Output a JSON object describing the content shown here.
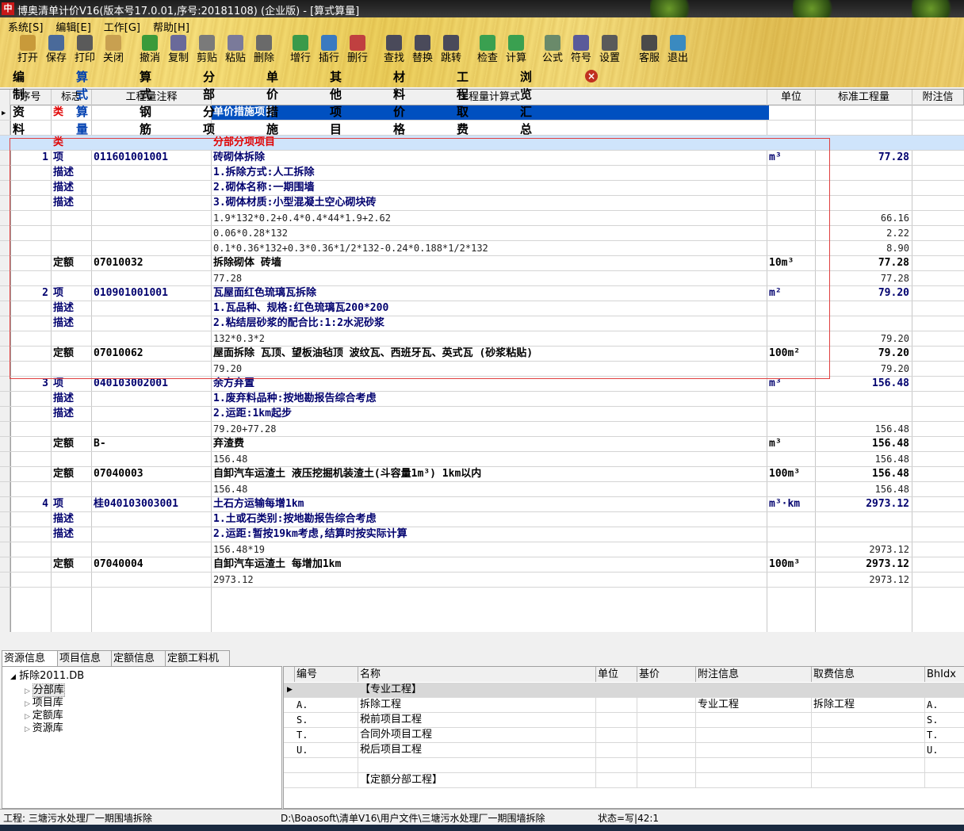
{
  "window": {
    "title": "博奥清单计价V16(版本号17.0.01,序号:20181108) (企业版) - [算式算量]",
    "app_icon": "中"
  },
  "menu": [
    "系统[S]",
    "编辑[E]",
    "工作[G]",
    "帮助[H]"
  ],
  "toolbar": [
    {
      "label": "打开",
      "icon": "folder-open-icon"
    },
    {
      "label": "保存",
      "icon": "save-icon"
    },
    {
      "label": "打印",
      "icon": "print-icon"
    },
    {
      "label": "关闭",
      "icon": "close-folder-icon"
    },
    {
      "label": "撤消",
      "icon": "undo-icon"
    },
    {
      "label": "复制",
      "icon": "copy-icon"
    },
    {
      "label": "剪贴",
      "icon": "cut-icon"
    },
    {
      "label": "粘贴",
      "icon": "paste-icon"
    },
    {
      "label": "删除",
      "icon": "delete-icon"
    },
    {
      "label": "增行",
      "icon": "add-row-icon"
    },
    {
      "label": "插行",
      "icon": "insert-row-icon"
    },
    {
      "label": "删行",
      "icon": "delete-row-icon"
    },
    {
      "label": "查找",
      "icon": "find-icon"
    },
    {
      "label": "替换",
      "icon": "replace-icon"
    },
    {
      "label": "跳转",
      "icon": "jump-icon"
    },
    {
      "label": "检查",
      "icon": "check-icon"
    },
    {
      "label": "计算",
      "icon": "calculate-icon"
    },
    {
      "label": "公式",
      "icon": "formula-icon"
    },
    {
      "label": "符号",
      "icon": "symbol-icon"
    },
    {
      "label": "设置",
      "icon": "settings-icon"
    },
    {
      "label": "客服",
      "icon": "headset-icon"
    },
    {
      "label": "退出",
      "icon": "exit-icon"
    }
  ],
  "tabs": [
    "编制资料",
    "算式算量",
    "算式钢筋",
    "分部分项",
    "单价措施",
    "其他项目",
    "材料价格",
    "工程取费",
    "浏览汇总"
  ],
  "active_tab": "算式算量",
  "grid": {
    "headers": [
      "序号",
      "标志",
      "工程量注释",
      "工程量计算式",
      "单位",
      "标准工程量",
      "附注信"
    ],
    "rows": [
      {
        "no": "",
        "flag": "类",
        "code": "",
        "formula": "单价措施项目",
        "unit": "",
        "qty": "",
        "style": "cat-selected"
      },
      {
        "no": "",
        "flag": "",
        "code": "",
        "formula": "",
        "unit": "",
        "qty": "",
        "style": "plain"
      },
      {
        "no": "",
        "flag": "类",
        "code": "",
        "formula": "分部分项项目",
        "unit": "",
        "qty": "",
        "style": "cat"
      },
      {
        "no": "1",
        "flag": "项",
        "code": "011601001001",
        "formula": "砖砌体拆除",
        "unit": "m³",
        "qty": "77.28",
        "style": "item"
      },
      {
        "no": "",
        "flag": "描述",
        "code": "",
        "formula": "1.拆除方式:人工拆除",
        "unit": "",
        "qty": "",
        "style": "desc"
      },
      {
        "no": "",
        "flag": "描述",
        "code": "",
        "formula": "2.砌体名称:一期围墙",
        "unit": "",
        "qty": "",
        "style": "desc"
      },
      {
        "no": "",
        "flag": "描述",
        "code": "",
        "formula": "3.砌体材质:小型混凝土空心砌块砖",
        "unit": "",
        "qty": "",
        "style": "desc"
      },
      {
        "no": "",
        "flag": "",
        "code": "",
        "formula": "1.9*132*0.2+0.4*0.4*44*1.9+2.62",
        "unit": "",
        "qty": "66.16",
        "style": "calc"
      },
      {
        "no": "",
        "flag": "",
        "code": "",
        "formula": "0.06*0.28*132",
        "unit": "",
        "qty": "2.22",
        "style": "calc"
      },
      {
        "no": "",
        "flag": "",
        "code": "",
        "formula": "0.1*0.36*132+0.3*0.36*1/2*132-0.24*0.188*1/2*132",
        "unit": "",
        "qty": "8.90",
        "style": "calc"
      },
      {
        "no": "",
        "flag": "定额",
        "code": "07010032",
        "formula": "拆除砌体 砖墙",
        "unit": "10m³",
        "qty": "77.28",
        "style": "quota"
      },
      {
        "no": "",
        "flag": "",
        "code": "",
        "formula": "77.28",
        "unit": "",
        "qty": "77.28",
        "style": "calc"
      },
      {
        "no": "2",
        "flag": "项",
        "code": "010901001001",
        "formula": "瓦屋面红色琉璃瓦拆除",
        "unit": "m²",
        "qty": "79.20",
        "style": "item"
      },
      {
        "no": "",
        "flag": "描述",
        "code": "",
        "formula": "1.瓦品种、规格:红色琉璃瓦200*200",
        "unit": "",
        "qty": "",
        "style": "desc"
      },
      {
        "no": "",
        "flag": "描述",
        "code": "",
        "formula": "2.粘结层砂浆的配合比:1:2水泥砂浆",
        "unit": "",
        "qty": "",
        "style": "desc"
      },
      {
        "no": "",
        "flag": "",
        "code": "",
        "formula": "132*0.3*2",
        "unit": "",
        "qty": "79.20",
        "style": "calc"
      },
      {
        "no": "",
        "flag": "定额",
        "code": "07010062",
        "formula": "屋面拆除 瓦顶、望板油毡顶 波纹瓦、西班牙瓦、英式瓦 (砂浆粘贴)",
        "unit": "100m²",
        "qty": "79.20",
        "style": "quota"
      },
      {
        "no": "",
        "flag": "",
        "code": "",
        "formula": "79.20",
        "unit": "",
        "qty": "79.20",
        "style": "calc"
      },
      {
        "no": "3",
        "flag": "项",
        "code": "040103002001",
        "formula": "余方弃置",
        "unit": "m³",
        "qty": "156.48",
        "style": "item"
      },
      {
        "no": "",
        "flag": "描述",
        "code": "",
        "formula": "1.废弃料品种:按地勘报告综合考虑",
        "unit": "",
        "qty": "",
        "style": "desc"
      },
      {
        "no": "",
        "flag": "描述",
        "code": "",
        "formula": "2.运距:1km起步",
        "unit": "",
        "qty": "",
        "style": "desc"
      },
      {
        "no": "",
        "flag": "",
        "code": "",
        "formula": "79.20+77.28",
        "unit": "",
        "qty": "156.48",
        "style": "calc"
      },
      {
        "no": "",
        "flag": "定额",
        "code": "B-",
        "formula": "弃渣费",
        "unit": "m³",
        "qty": "156.48",
        "style": "quota"
      },
      {
        "no": "",
        "flag": "",
        "code": "",
        "formula": "156.48",
        "unit": "",
        "qty": "156.48",
        "style": "calc"
      },
      {
        "no": "",
        "flag": "定额",
        "code": "07040003",
        "formula": "自卸汽车运渣土 液压挖掘机装渣土(斗容量1m³) 1km以内",
        "unit": "100m³",
        "qty": "156.48",
        "style": "quota"
      },
      {
        "no": "",
        "flag": "",
        "code": "",
        "formula": "156.48",
        "unit": "",
        "qty": "156.48",
        "style": "calc"
      },
      {
        "no": "4",
        "flag": "项",
        "code": "桂040103003001",
        "formula": "土石方运输每增1km",
        "unit": "m³·km",
        "qty": "2973.12",
        "style": "item"
      },
      {
        "no": "",
        "flag": "描述",
        "code": "",
        "formula": "1.土或石类别:按地勘报告综合考虑",
        "unit": "",
        "qty": "",
        "style": "desc"
      },
      {
        "no": "",
        "flag": "描述",
        "code": "",
        "formula": "2.运距:暂按19km考虑,结算时按实际计算",
        "unit": "",
        "qty": "",
        "style": "desc"
      },
      {
        "no": "",
        "flag": "",
        "code": "",
        "formula": "156.48*19",
        "unit": "",
        "qty": "2973.12",
        "style": "calc"
      },
      {
        "no": "",
        "flag": "定额",
        "code": "07040004",
        "formula": "自卸汽车运渣土 每增加1km",
        "unit": "100m³",
        "qty": "2973.12",
        "style": "quota"
      },
      {
        "no": "",
        "flag": "",
        "code": "",
        "formula": "2973.12",
        "unit": "",
        "qty": "2973.12",
        "style": "calc"
      }
    ]
  },
  "bottom_tabs": [
    "资源信息",
    "项目信息",
    "定额信息",
    "定额工料机"
  ],
  "tree": {
    "root": "拆除2011.DB",
    "children": [
      "分部库",
      "项目库",
      "定额库",
      "资源库"
    ]
  },
  "resource_grid": {
    "headers": [
      "编号",
      "名称",
      "单位",
      "基价",
      "附注信息",
      "取费信息",
      "BhIdx"
    ],
    "rows": [
      {
        "code": "",
        "name": "【专业工程】",
        "unit": "",
        "price": "",
        "note": "",
        "fee": "",
        "idx": "",
        "selected": true
      },
      {
        "code": "A.",
        "name": "拆除工程",
        "unit": "",
        "price": "",
        "note": "专业工程",
        "fee": "拆除工程",
        "idx": "A."
      },
      {
        "code": "S.",
        "name": "税前项目工程",
        "unit": "",
        "price": "",
        "note": "",
        "fee": "",
        "idx": "S."
      },
      {
        "code": "T.",
        "name": "合同外项目工程",
        "unit": "",
        "price": "",
        "note": "",
        "fee": "",
        "idx": "T."
      },
      {
        "code": "U.",
        "name": "税后项目工程",
        "unit": "",
        "price": "",
        "note": "",
        "fee": "",
        "idx": "U."
      },
      {
        "code": "",
        "name": "",
        "unit": "",
        "price": "",
        "note": "",
        "fee": "",
        "idx": ""
      },
      {
        "code": "",
        "name": "【定额分部工程】",
        "unit": "",
        "price": "",
        "note": "",
        "fee": "",
        "idx": ""
      }
    ]
  },
  "status": {
    "project": "工程: 三塘污水处理厂一期围墙拆除",
    "path": "D:\\Boaosoft\\清单V16\\用户文件\\三塘污水处理厂一期围墙拆除",
    "state": "状态=写|42:1"
  },
  "colors": {
    "item": "#00006e",
    "desc": "#00006e",
    "cat": "#e00000",
    "selected_bg": "#0050c0",
    "cat_row_bg": "#cfe4fb",
    "highlight_box": "#e04040"
  }
}
